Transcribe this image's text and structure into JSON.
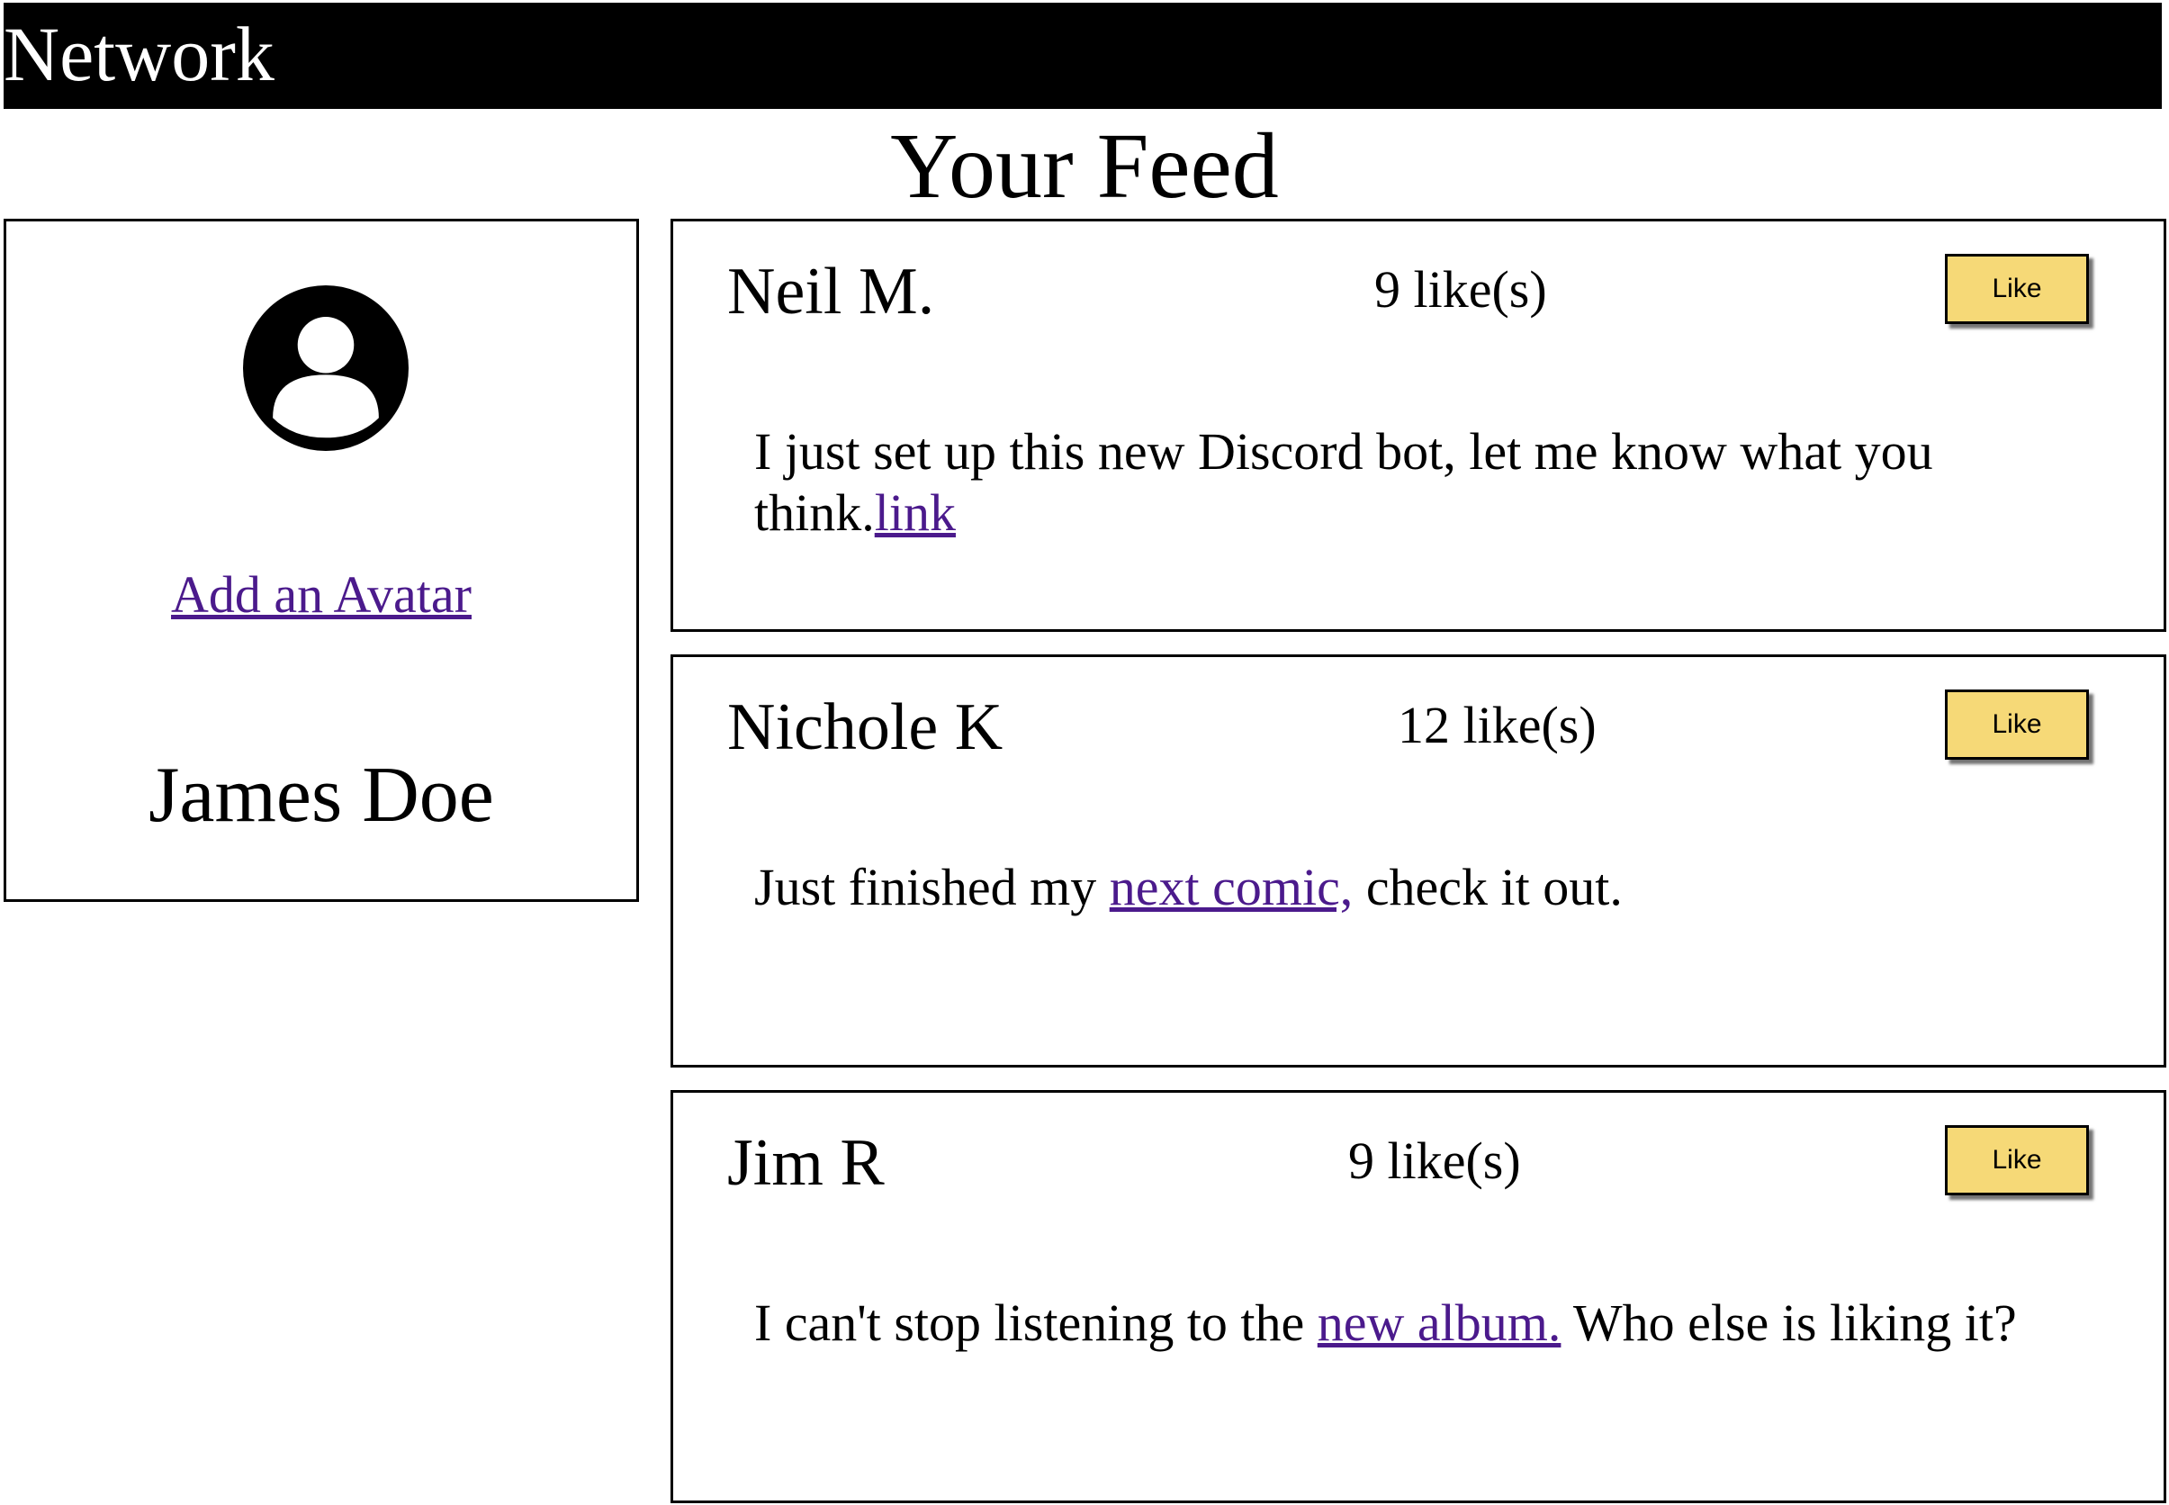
{
  "header": {
    "brand": "Network"
  },
  "page": {
    "title": "Your Feed"
  },
  "profile": {
    "add_avatar_label": "Add an Avatar",
    "name": "James Doe",
    "avatar_icon": "user-circle-icon"
  },
  "colors": {
    "header_bg": "#000000",
    "like_button_bg": "#f6d977",
    "link": "#4b1a8c"
  },
  "posts": [
    {
      "author": "Neil M.",
      "likes": "9 like(s)",
      "like_label": "Like",
      "text_before": "I just set up this new Discord bot, let me know what you think.",
      "link_text": "link",
      "text_after": ""
    },
    {
      "author": "Nichole K",
      "likes": "12 like(s)",
      "like_label": "Like",
      "text_before": "Just finished my ",
      "link_text": "next comic,",
      "text_after": " check it out."
    },
    {
      "author": "Jim R",
      "likes": "9 like(s)",
      "like_label": "Like",
      "text_before": "I can't stop listening to the ",
      "link_text": "new album.",
      "text_after": " Who else is liking it?"
    }
  ]
}
